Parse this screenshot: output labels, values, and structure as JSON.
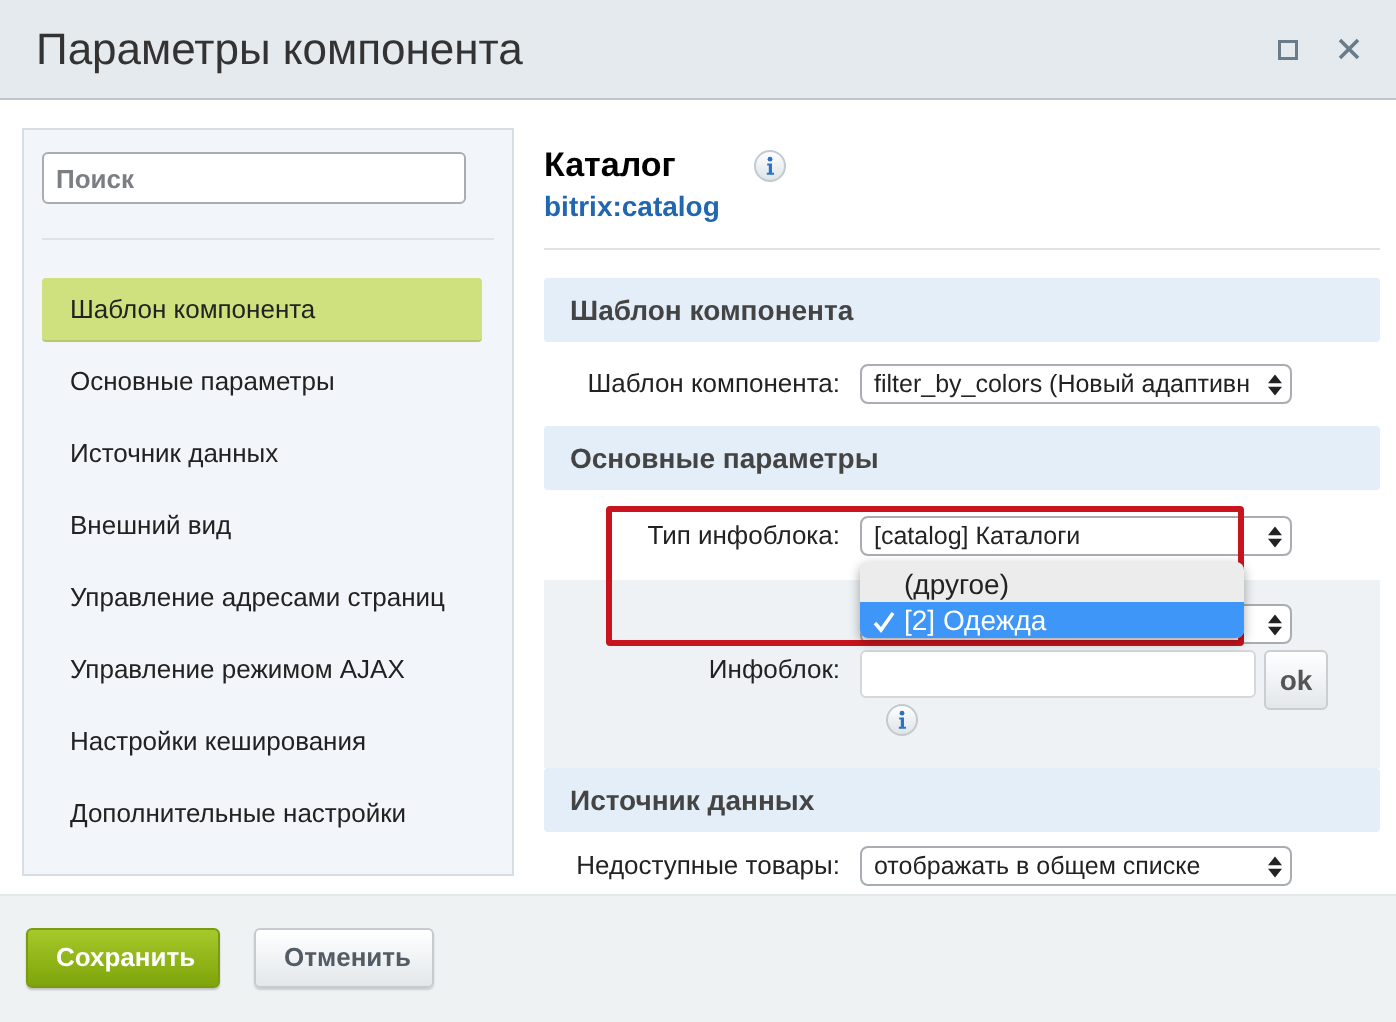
{
  "window": {
    "title": "Параметры компонента"
  },
  "sidebar": {
    "search": {
      "placeholder": "Поиск"
    },
    "items": [
      {
        "label": "Шаблон компонента",
        "selected": true
      },
      {
        "label": "Основные параметры",
        "selected": false
      },
      {
        "label": "Источник данных",
        "selected": false
      },
      {
        "label": "Внешний вид",
        "selected": false
      },
      {
        "label": "Управление адресами страниц",
        "selected": false
      },
      {
        "label": "Управление режимом AJAX",
        "selected": false
      },
      {
        "label": "Настройки кеширования",
        "selected": false
      },
      {
        "label": "Дополнительные настройки",
        "selected": false
      }
    ]
  },
  "component": {
    "name": "Каталог",
    "code": "bitrix:catalog"
  },
  "sections": [
    {
      "title": "Шаблон компонента",
      "rows": [
        {
          "kind": "select",
          "label": "Шаблон компонента:",
          "value": "filter_by_colors (Новый адаптивн",
          "highlighted": false
        }
      ]
    },
    {
      "title": "Основные параметры",
      "rows": [
        {
          "kind": "select",
          "label": "Тип инфоблока:",
          "value": "[catalog] Каталоги",
          "highlighted": false,
          "open": true
        },
        {
          "kind": "select",
          "highlighted": true
        },
        {
          "kind": "input",
          "label": "Инфоблок:",
          "button": "ok",
          "highlighted": true
        }
      ]
    },
    {
      "title": "Источник данных",
      "rows": [
        {
          "kind": "select",
          "label": "Недоступные товары:",
          "value": "отображать в общем списке",
          "highlighted": false
        }
      ]
    }
  ],
  "dropdown": {
    "options": [
      {
        "label": "(другое)",
        "selected": false
      },
      {
        "label": "[2] Одежда",
        "selected": true
      }
    ]
  },
  "footer": {
    "buttons": [
      {
        "label": "Сохранить",
        "kind": "primary"
      },
      {
        "label": "Отменить",
        "kind": "secondary"
      }
    ]
  }
}
